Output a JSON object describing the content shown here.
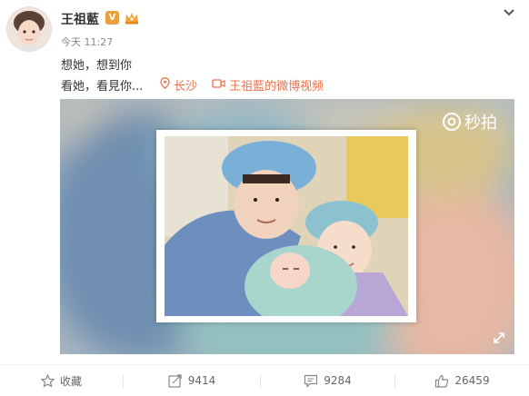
{
  "post": {
    "author": "王祖藍",
    "verified_badge": "V",
    "time": "今天 11:27",
    "text_line1": "想她，想到你",
    "text_line2": "看她，看見你...",
    "location": "长沙",
    "video_link": "王祖藍的微博视频"
  },
  "video": {
    "watermark": "秒拍"
  },
  "actions": {
    "favorite_label": "收藏",
    "repost_count": "9414",
    "comment_count": "9284",
    "like_count": "26459"
  },
  "colors": {
    "link": "#eb7350",
    "badge": "#e8a03b",
    "text": "#333333",
    "muted": "#888888"
  },
  "icons": [
    "chevron-down-icon",
    "location-pin-icon",
    "video-icon",
    "fullscreen-icon",
    "star-icon",
    "repost-icon",
    "comment-icon",
    "thumbs-up-icon"
  ]
}
